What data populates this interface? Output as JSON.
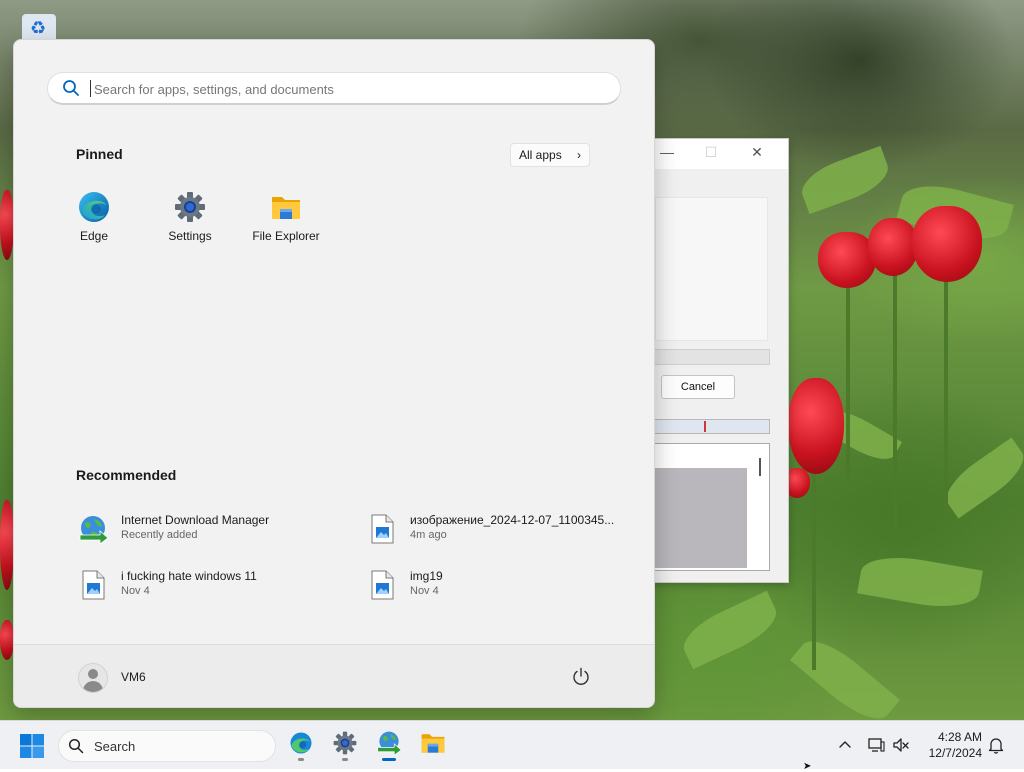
{
  "desktop": {
    "recycle_bin_icon": "recycle-bin-icon",
    "wallpaper": "red tulips and green foliage"
  },
  "background_dialog": {
    "cancel_label": "Cancel"
  },
  "start_menu": {
    "search": {
      "placeholder": "Search for apps, settings, and documents",
      "value": ""
    },
    "pinned_title": "Pinned",
    "all_apps_label": "All apps",
    "pinned": [
      {
        "label": "Edge",
        "icon": "edge-icon"
      },
      {
        "label": "Settings",
        "icon": "settings-gear-icon"
      },
      {
        "label": "File Explorer",
        "icon": "file-explorer-folder-icon"
      }
    ],
    "recommended_title": "Recommended",
    "recommended": [
      {
        "title": "Internet Download Manager",
        "subtitle": "Recently added",
        "icon": "idm-globe-icon"
      },
      {
        "title": "изображение_2024-12-07_1100345...",
        "subtitle": "4m ago",
        "icon": "image-file-icon"
      },
      {
        "title": "i fucking hate windows 11",
        "subtitle": "Nov 4",
        "icon": "image-file-icon"
      },
      {
        "title": "img19",
        "subtitle": "Nov 4",
        "icon": "image-file-icon"
      }
    ],
    "user_name": "VM6",
    "power_icon": "power-icon"
  },
  "taskbar": {
    "search_label": "Search",
    "apps": [
      "edge",
      "settings",
      "internet-download-manager",
      "file-explorer"
    ],
    "clock_time": "4:28 AM",
    "clock_date": "12/7/2024"
  },
  "colors": {
    "accent": "#0067c0",
    "start_bg": "#f2f2f2",
    "taskbar_bg": "#eef0f3"
  }
}
